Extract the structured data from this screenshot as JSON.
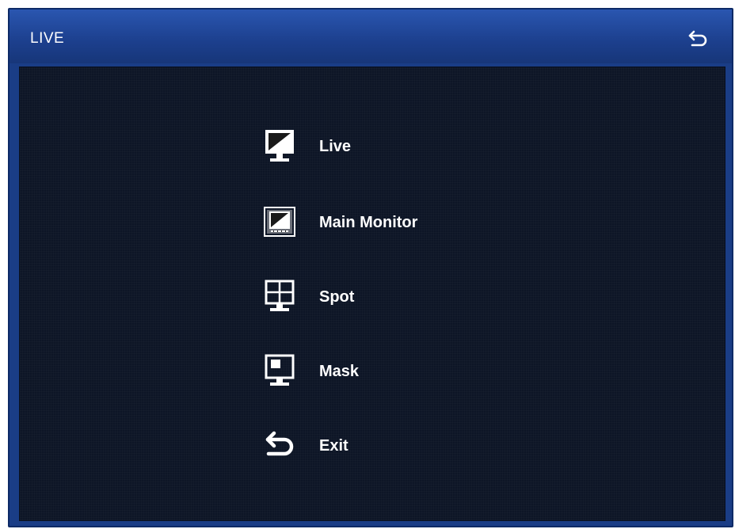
{
  "window": {
    "title": "LIVE",
    "back_icon": "back-arrow-icon"
  },
  "menu": {
    "items": [
      {
        "label": "Live",
        "icon": "monitor-icon"
      },
      {
        "label": "Main Monitor",
        "icon": "main-monitor-icon"
      },
      {
        "label": "Spot",
        "icon": "quad-split-monitor-icon"
      },
      {
        "label": "Mask",
        "icon": "mask-monitor-icon"
      },
      {
        "label": "Exit",
        "icon": "exit-arrow-icon"
      }
    ]
  },
  "colors": {
    "titlebar": "#1c3f8d",
    "content_bg": "#0d1526",
    "text": "#ffffff"
  }
}
